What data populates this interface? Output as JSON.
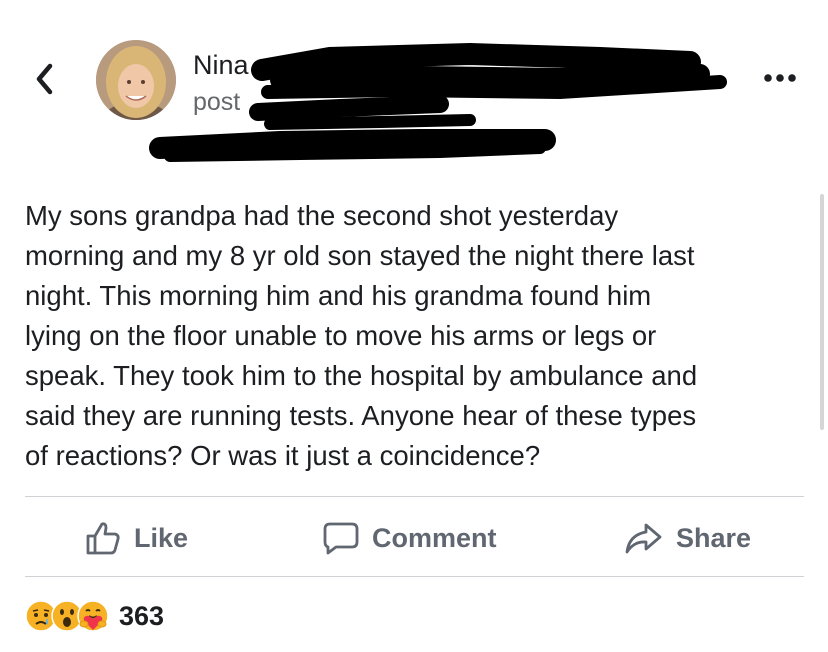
{
  "header": {
    "author_name": "Nina",
    "subtitle": "post"
  },
  "icons": {
    "back": "chevron-left-icon",
    "more": "more-options-icon",
    "like": "thumbs-up-icon",
    "comment": "speech-bubble-icon",
    "share": "share-arrow-icon"
  },
  "post": {
    "lines": [
      "My sons grandpa had the second shot yesterday",
      "morning and my 8 yr old son stayed the night there last",
      "night.  This morning him and his grandma found him",
      "lying on the floor unable to move his arms or legs or",
      "speak.  They took him to the hospital by ambulance and",
      "said they are running tests.  Anyone hear of these types",
      "of reactions? Or was it just a coincidence?"
    ]
  },
  "actions": {
    "like_label": "Like",
    "comment_label": "Comment",
    "share_label": "Share"
  },
  "reactions": {
    "types": [
      "sad",
      "wow",
      "care"
    ],
    "count": "363"
  },
  "colors": {
    "text": "#1c1e21",
    "secondary_text": "#65676b",
    "action_text": "#606770",
    "divider": "#d0d2d6",
    "reaction_yellow": "#f7b125"
  }
}
